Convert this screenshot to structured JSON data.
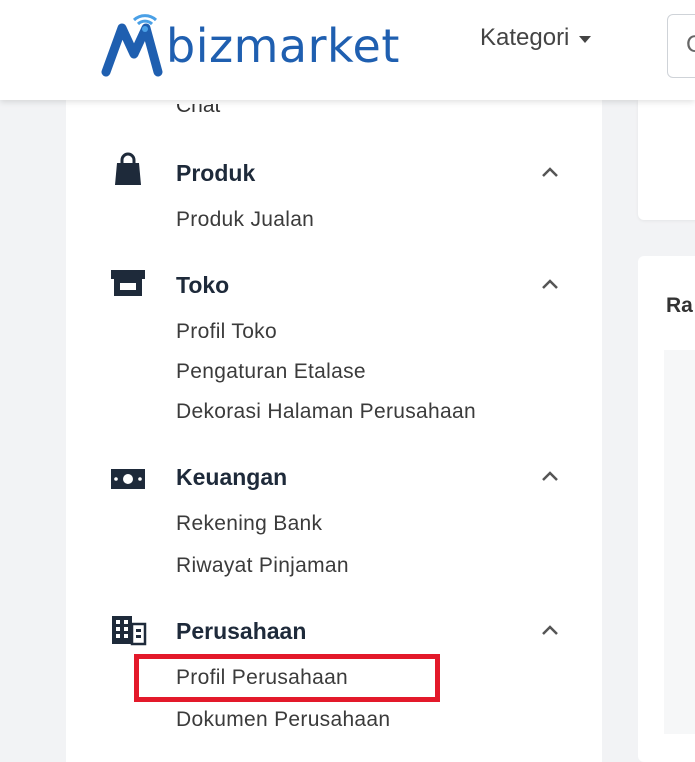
{
  "header": {
    "logo_text": "bizmarket",
    "category_label": "Kategori",
    "search_hint": "C"
  },
  "sidebar": {
    "partial_item": "Chat",
    "sections": [
      {
        "title": "Produk",
        "icon": "shopping-bag-icon",
        "items": [
          "Produk Jualan"
        ]
      },
      {
        "title": "Toko",
        "icon": "store-icon",
        "items": [
          "Profil Toko",
          "Pengaturan Etalase",
          "Dekorasi Halaman Perusahaan"
        ]
      },
      {
        "title": "Keuangan",
        "icon": "money-icon",
        "items": [
          "Rekening Bank",
          "Riwayat Pinjaman"
        ]
      },
      {
        "title": "Perusahaan",
        "icon": "building-icon",
        "items": [
          "Profil Perusahaan",
          "Dokumen Perusahaan"
        ]
      }
    ],
    "highlighted_item": "Profil Perusahaan",
    "highlight_color": "#e3192a"
  },
  "content": {
    "panel_label": "Ra"
  },
  "colors": {
    "brand": "#1f5fb0",
    "brand_accent": "#4aa0e6"
  }
}
